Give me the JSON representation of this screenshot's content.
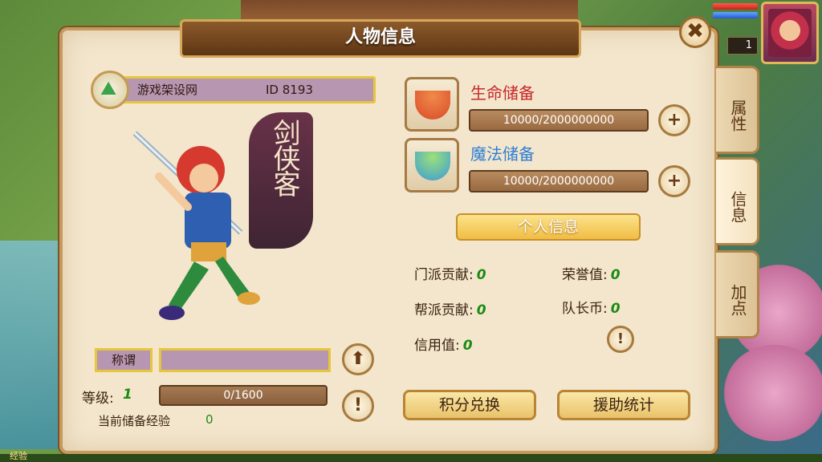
{
  "window": {
    "title": "人物信息",
    "close_label": "✖"
  },
  "player": {
    "level_badge": "1"
  },
  "side_tabs": [
    {
      "label": "属性"
    },
    {
      "label": "信息"
    },
    {
      "label": "加点"
    }
  ],
  "character": {
    "name": "游戏架设网",
    "id_text": "ID 8193",
    "class_emblem": "剑侠客",
    "title_label": "称谓",
    "title_value": "",
    "level_label": "等级:",
    "level_value": "1",
    "exp_progress": "0/1600",
    "stored_exp_label": "当前储备经验",
    "stored_exp_value": "0"
  },
  "reserves": {
    "hp_label": "生命储备",
    "hp_value": "10000/2000000000",
    "mp_label": "魔法储备",
    "mp_value": "10000/2000000000"
  },
  "personal_info": {
    "section_label": "个人信息",
    "sect_contribution_label": "门派贡献:",
    "sect_contribution_value": "0",
    "honor_label": "荣誉值:",
    "honor_value": "0",
    "guild_contribution_label": "帮派贡献:",
    "guild_contribution_value": "0",
    "captain_coin_label": "队长币:",
    "captain_coin_value": "0",
    "credit_label": "信用值:",
    "credit_value": "0"
  },
  "buttons": {
    "points_exchange": "积分兑换",
    "assist_stats": "援助统计",
    "plus": "+",
    "info": "!",
    "upload": "⬆"
  },
  "hud": {
    "exp_tag": "经验"
  },
  "colors": {
    "hp_label": "#c8282b",
    "mp_label": "#2f7fd6",
    "value_green": "#1a8a14"
  }
}
